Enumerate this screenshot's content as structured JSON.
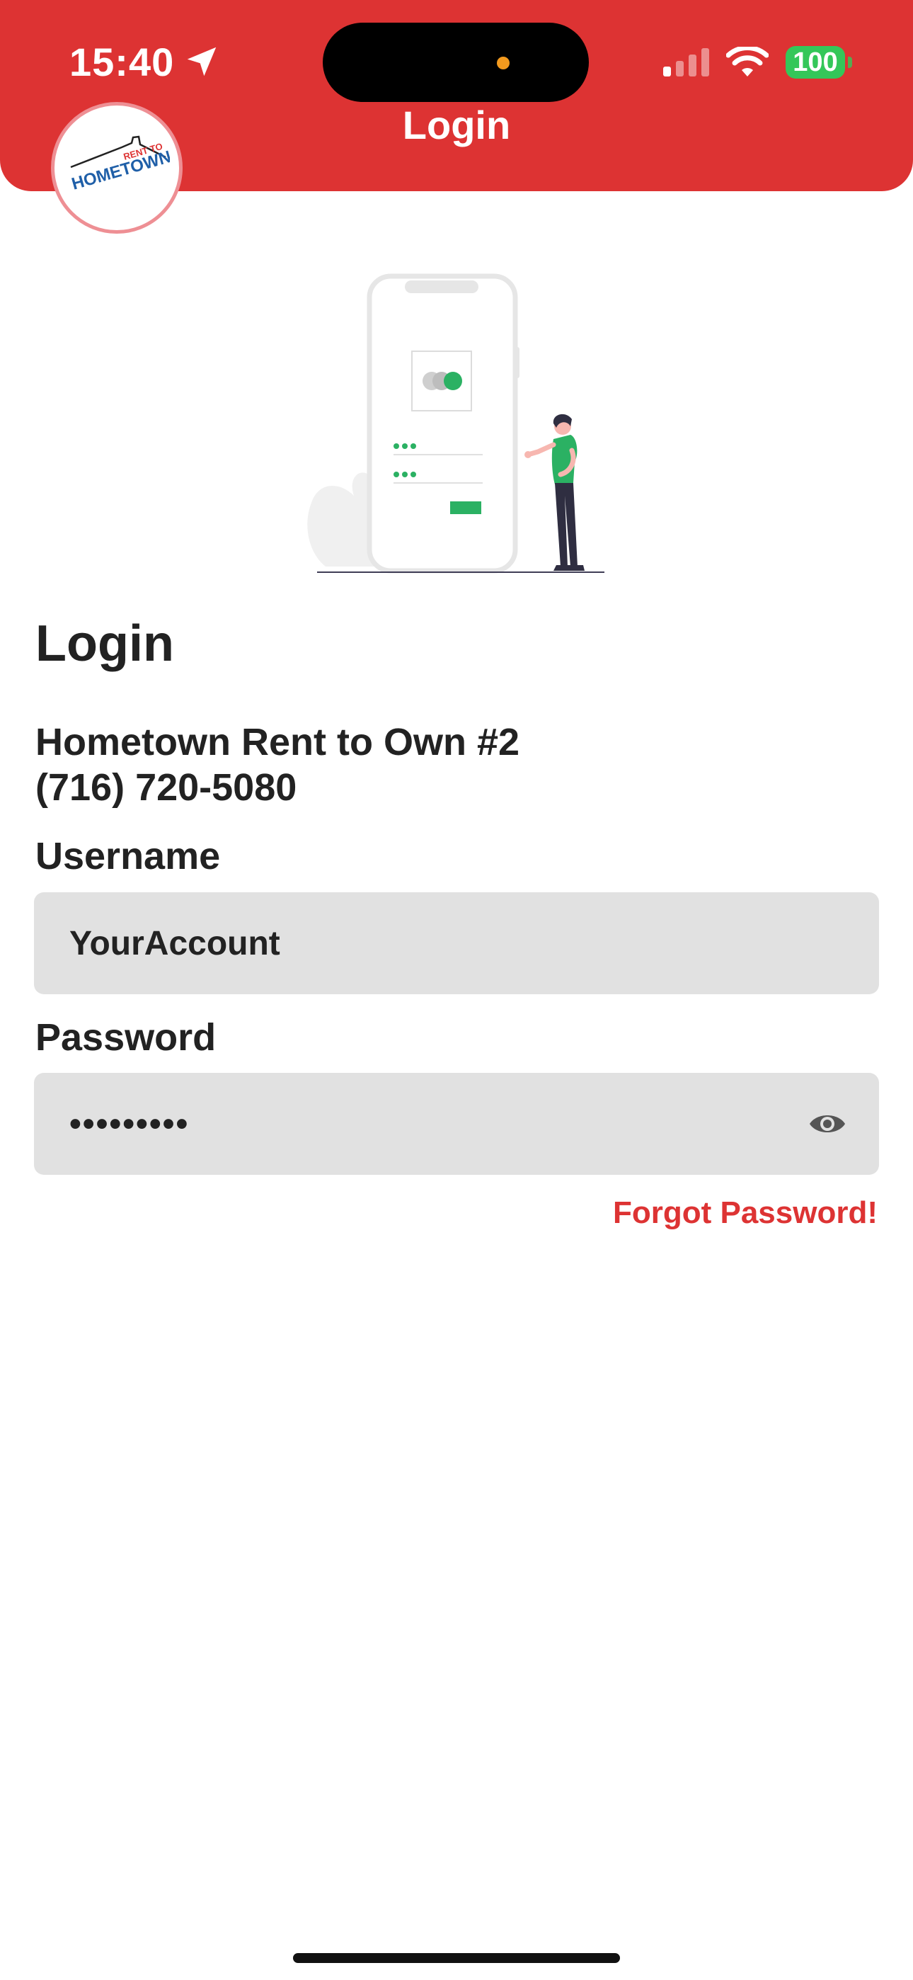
{
  "status_bar": {
    "time": "15:40",
    "battery": "100",
    "icons": [
      "location-arrow-icon",
      "cellular-signal-icon",
      "wifi-icon",
      "battery-icon"
    ]
  },
  "header": {
    "title": "Login",
    "logo": {
      "line1": "RENT TO",
      "line2": "HOMETOWN"
    }
  },
  "main": {
    "heading": "Login",
    "store_name": "Hometown Rent to Own #2",
    "store_phone": "(716) 720-5080"
  },
  "form": {
    "username_label": "Username",
    "username_value": "YourAccount",
    "password_label": "Password",
    "password_value": "•••••••••",
    "forgot_link": "Forgot Password!"
  },
  "colors": {
    "brand_red": "#dd3333",
    "accent_green": "#2bb163",
    "input_bg": "#e1e1e1"
  }
}
